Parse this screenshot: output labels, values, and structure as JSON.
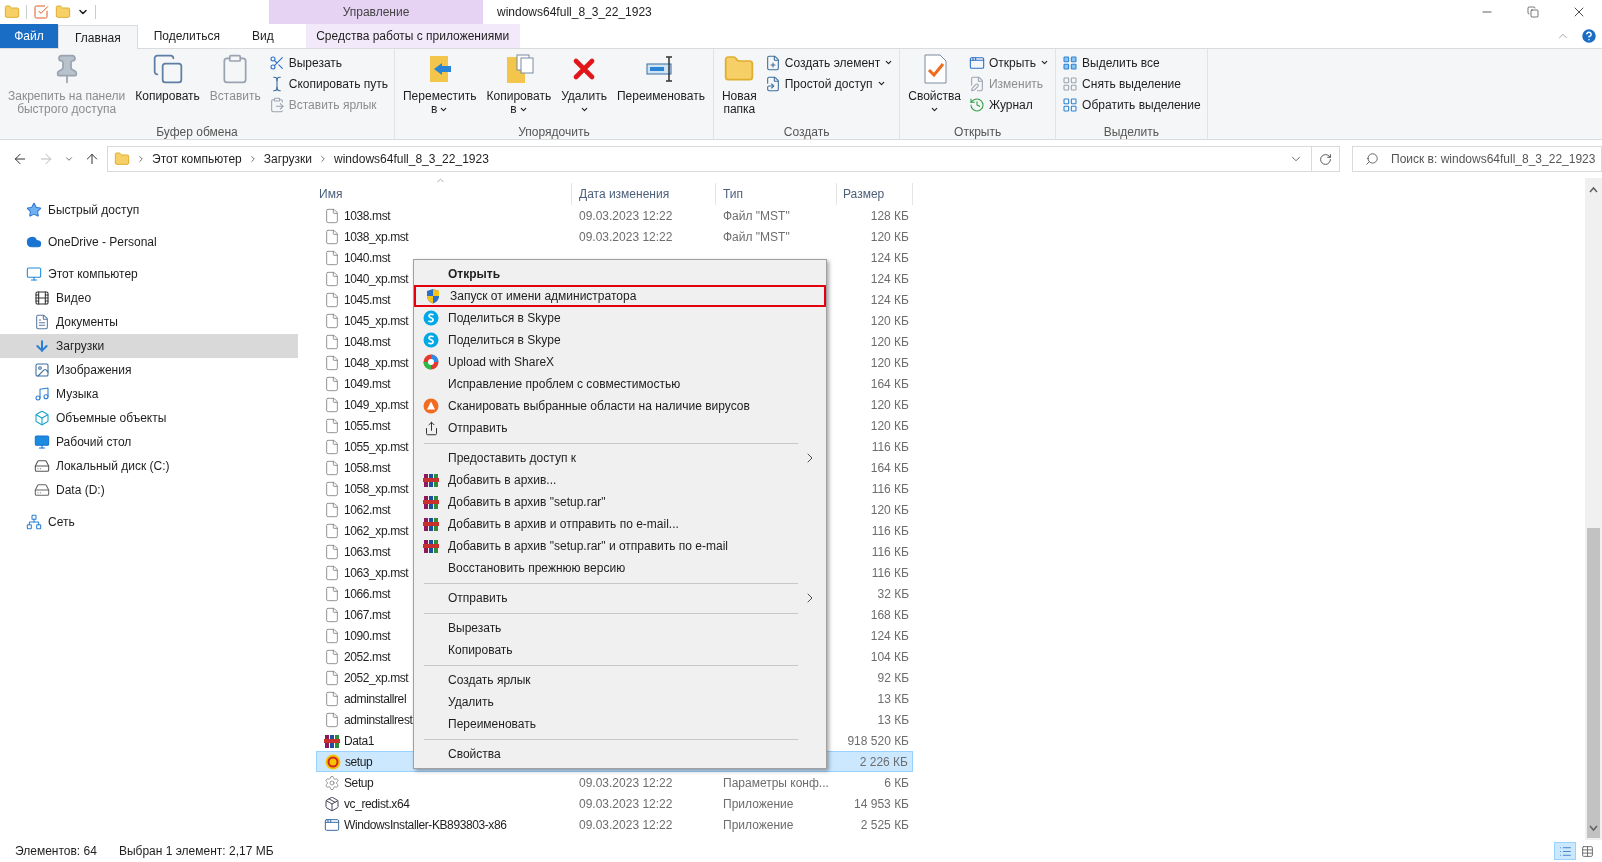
{
  "title_bar": {
    "contextual_header": "Управление",
    "title": "windows64full_8_3_22_1923"
  },
  "ribbon_tabs": [
    {
      "label": "Файл",
      "kind": "file",
      "selected": false
    },
    {
      "label": "Главная",
      "kind": "tab",
      "selected": true
    },
    {
      "label": "Поделиться",
      "kind": "tab",
      "selected": false
    },
    {
      "label": "Вид",
      "kind": "tab",
      "selected": false
    },
    {
      "label": "Средства работы с приложениями",
      "kind": "contextual",
      "selected": false
    }
  ],
  "ribbon_groups": [
    {
      "label": "Буфер обмена",
      "items": [
        {
          "kind": "pin",
          "lines": [
            "Закрепить на панели",
            "быстрого доступа"
          ],
          "disabled": true,
          "dropdown": false
        },
        {
          "kind": "copy",
          "lines": [
            "Копировать"
          ],
          "disabled": false,
          "dropdown": false
        },
        {
          "kind": "paste",
          "lines": [
            "Вставить"
          ],
          "disabled": true,
          "dropdown": false
        },
        {
          "stack": [
            {
              "kind": "cut",
              "label": "Вырезать",
              "disabled": false,
              "dropdown": false
            },
            {
              "kind": "copy-path",
              "label": "Скопировать путь",
              "disabled": false,
              "dropdown": false
            },
            {
              "kind": "paste-shortcut",
              "label": "Вставить ярлык",
              "disabled": true,
              "dropdown": false
            }
          ]
        }
      ]
    },
    {
      "label": "Упорядочить",
      "items": [
        {
          "kind": "move-to",
          "lines": [
            "Переместить",
            "в"
          ],
          "disabled": false,
          "dropdown": true
        },
        {
          "kind": "copy-to",
          "lines": [
            "Копировать",
            "в"
          ],
          "disabled": false,
          "dropdown": true
        },
        {
          "kind": "delete",
          "lines": [
            "Удалить"
          ],
          "disabled": false,
          "dropdown": true
        },
        {
          "kind": "rename",
          "lines": [
            "Переименовать"
          ],
          "disabled": false,
          "dropdown": false
        }
      ]
    },
    {
      "label": "Создать",
      "items": [
        {
          "kind": "new-folder",
          "lines": [
            "Новая",
            "папка"
          ],
          "disabled": false,
          "dropdown": false
        },
        {
          "stack": [
            {
              "kind": "new-item",
              "label": "Создать элемент",
              "disabled": false,
              "dropdown": true
            },
            {
              "kind": "easy-access",
              "label": "Простой доступ",
              "disabled": false,
              "dropdown": true
            }
          ]
        }
      ]
    },
    {
      "label": "Открыть",
      "items": [
        {
          "kind": "properties",
          "lines": [
            "Свойства"
          ],
          "disabled": false,
          "dropdown": true
        },
        {
          "stack": [
            {
              "kind": "open",
              "label": "Открыть",
              "disabled": false,
              "dropdown": true
            },
            {
              "kind": "edit",
              "label": "Изменить",
              "disabled": true,
              "dropdown": false
            },
            {
              "kind": "history",
              "label": "Журнал",
              "disabled": false,
              "dropdown": false
            }
          ]
        }
      ]
    },
    {
      "label": "Выделить",
      "items": [
        {
          "stack": [
            {
              "kind": "select-all",
              "label": "Выделить все",
              "disabled": false,
              "dropdown": false
            },
            {
              "kind": "select-none",
              "label": "Снять выделение",
              "disabled": false,
              "dropdown": false
            },
            {
              "kind": "invert",
              "label": "Обратить выделение",
              "disabled": false,
              "dropdown": false
            }
          ]
        }
      ]
    }
  ],
  "address_bar": {
    "path": [
      "Этот компьютер",
      "Загрузки",
      "windows64full_8_3_22_1923"
    ],
    "search_placeholder": "Поиск в: windows64full_8_3_22_1923"
  },
  "nav_pane": {
    "items": [
      {
        "label": "Быстрый доступ",
        "kind": "quick-access",
        "selected": false
      },
      {
        "label": "OneDrive - Personal",
        "kind": "cloud",
        "selected": false
      },
      {
        "label": "Этот компьютер",
        "kind": "computer",
        "selected": false,
        "children": [
          {
            "label": "Видео",
            "kind": "video",
            "selected": false
          },
          {
            "label": "Документы",
            "kind": "documents",
            "selected": false
          },
          {
            "label": "Загрузки",
            "kind": "downloads",
            "selected": true
          },
          {
            "label": "Изображения",
            "kind": "pictures",
            "selected": false
          },
          {
            "label": "Музыка",
            "kind": "music",
            "selected": false
          },
          {
            "label": "Объемные объекты",
            "kind": "objects",
            "selected": false
          },
          {
            "label": "Рабочий стол",
            "kind": "desktop",
            "selected": false
          },
          {
            "label": "Локальный диск (C:)",
            "kind": "system-drive",
            "selected": false
          },
          {
            "label": "Data (D:)",
            "kind": "drive",
            "selected": false
          }
        ]
      },
      {
        "label": "Сеть",
        "kind": "network",
        "selected": false
      }
    ]
  },
  "file_list": {
    "columns": [
      "Имя",
      "Дата изменения",
      "Тип",
      "Размер"
    ],
    "rows": [
      {
        "name": "1038.mst",
        "kind": "document",
        "date": "09.03.2023 12:22",
        "type": "Файл \"MST\"",
        "size": "128 КБ",
        "selected": false
      },
      {
        "name": "1038_xp.mst",
        "kind": "document",
        "date": "09.03.2023 12:22",
        "type": "Файл \"MST\"",
        "size": "120 КБ",
        "selected": false
      },
      {
        "name": "1040.mst",
        "kind": "document",
        "size": "124 КБ",
        "selected": false
      },
      {
        "name": "1040_xp.mst",
        "kind": "document",
        "size": "124 КБ",
        "selected": false
      },
      {
        "name": "1045.mst",
        "kind": "document",
        "size": "124 КБ",
        "selected": false
      },
      {
        "name": "1045_xp.mst",
        "kind": "document",
        "size": "120 КБ",
        "selected": false
      },
      {
        "name": "1048.mst",
        "kind": "document",
        "size": "120 КБ",
        "selected": false
      },
      {
        "name": "1048_xp.mst",
        "kind": "document",
        "size": "120 КБ",
        "selected": false
      },
      {
        "name": "1049.mst",
        "kind": "document",
        "size": "164 КБ",
        "selected": false
      },
      {
        "name": "1049_xp.mst",
        "kind": "document",
        "size": "120 КБ",
        "selected": false
      },
      {
        "name": "1055.mst",
        "kind": "document",
        "size": "120 КБ",
        "selected": false
      },
      {
        "name": "1055_xp.mst",
        "kind": "document",
        "size": "116 КБ",
        "selected": false
      },
      {
        "name": "1058.mst",
        "kind": "document",
        "size": "164 КБ",
        "selected": false
      },
      {
        "name": "1058_xp.mst",
        "kind": "document",
        "size": "116 КБ",
        "selected": false
      },
      {
        "name": "1062.mst",
        "kind": "document",
        "size": "120 КБ",
        "selected": false
      },
      {
        "name": "1062_xp.mst",
        "kind": "document",
        "size": "116 КБ",
        "selected": false
      },
      {
        "name": "1063.mst",
        "kind": "document",
        "size": "116 КБ",
        "selected": false
      },
      {
        "name": "1063_xp.mst",
        "kind": "document",
        "size": "116 КБ",
        "selected": false
      },
      {
        "name": "1066.mst",
        "kind": "document",
        "size": "32 КБ",
        "selected": false
      },
      {
        "name": "1067.mst",
        "kind": "document",
        "size": "168 КБ",
        "selected": false
      },
      {
        "name": "1090.mst",
        "kind": "document",
        "size": "124 КБ",
        "selected": false
      },
      {
        "name": "2052.mst",
        "kind": "document",
        "size": "104 КБ",
        "selected": false
      },
      {
        "name": "2052_xp.mst",
        "kind": "document",
        "size": "92 КБ",
        "selected": false
      },
      {
        "name": "adminstallrel",
        "kind": "document",
        "size": "13 КБ",
        "selected": false
      },
      {
        "name": "adminstallrest",
        "kind": "document",
        "size": "13 КБ",
        "selected": false
      },
      {
        "name": "Data1",
        "kind": "archive",
        "size": "918 520 КБ",
        "selected": false
      },
      {
        "name": "setup",
        "kind": "app",
        "size": "2 226 КБ",
        "selected": true
      },
      {
        "name": "Setup",
        "kind": "config",
        "date": "09.03.2023 12:22",
        "type": "Параметры конф...",
        "size": "6 КБ",
        "selected": false
      },
      {
        "name": "vc_redist.x64",
        "kind": "installer",
        "date": "09.03.2023 12:22",
        "type": "Приложение",
        "size": "14 953 КБ",
        "selected": false
      },
      {
        "name": "WindowsInstaller-KB893803-x86",
        "kind": "window-app",
        "date": "09.03.2023 12:22",
        "type": "Приложение",
        "size": "2 525 КБ",
        "selected": false
      }
    ]
  },
  "context_menu": {
    "items": [
      {
        "kind": "plain",
        "label": "Открыть",
        "default": true,
        "highlighted": false
      },
      {
        "kind": "shield",
        "label": "Запуск от имени администратора",
        "default": false,
        "highlighted": true
      },
      {
        "kind": "skype",
        "label": "Поделиться в Skype",
        "default": false,
        "highlighted": false
      },
      {
        "kind": "skype",
        "label": "Поделиться в Skype",
        "default": false,
        "highlighted": false
      },
      {
        "kind": "sharex",
        "label": "Upload with ShareX",
        "default": false,
        "highlighted": false
      },
      {
        "kind": "plain",
        "label": "Исправление проблем с совместимостью",
        "default": false,
        "highlighted": false
      },
      {
        "kind": "antivirus",
        "label": "Сканировать выбранные области на наличие вирусов",
        "default": false,
        "highlighted": false
      },
      {
        "kind": "send",
        "label": "Отправить",
        "default": false,
        "highlighted": false
      },
      {
        "kind": "separator"
      },
      {
        "kind": "submenu",
        "label": "Предоставить доступ к",
        "default": false,
        "highlighted": false
      },
      {
        "kind": "archive",
        "label": "Добавить в архив...",
        "default": false,
        "highlighted": false
      },
      {
        "kind": "archive",
        "label": "Добавить в архив \"setup.rar\"",
        "default": false,
        "highlighted": false
      },
      {
        "kind": "archive",
        "label": "Добавить в архив и отправить по e-mail...",
        "default": false,
        "highlighted": false
      },
      {
        "kind": "archive",
        "label": "Добавить в архив \"setup.rar\" и отправить по e-mail",
        "default": false,
        "highlighted": false
      },
      {
        "kind": "plain",
        "label": "Восстановить прежнюю версию",
        "default": false,
        "highlighted": false
      },
      {
        "kind": "separator"
      },
      {
        "kind": "submenu",
        "label": "Отправить",
        "default": false,
        "highlighted": false
      },
      {
        "kind": "separator"
      },
      {
        "kind": "plain",
        "label": "Вырезать",
        "default": false,
        "highlighted": false
      },
      {
        "kind": "plain",
        "label": "Копировать",
        "default": false,
        "highlighted": false
      },
      {
        "kind": "separator"
      },
      {
        "kind": "plain",
        "label": "Создать ярлык",
        "default": false,
        "highlighted": false
      },
      {
        "kind": "plain",
        "label": "Удалить",
        "default": false,
        "highlighted": false
      },
      {
        "kind": "plain",
        "label": "Переименовать",
        "default": false,
        "highlighted": false
      },
      {
        "kind": "separator"
      },
      {
        "kind": "plain",
        "label": "Свойства",
        "default": false,
        "highlighted": false
      }
    ]
  },
  "status_bar": {
    "item_count": "Элементов: 64",
    "selection": "Выбран 1 элемент: 2,17 МБ"
  }
}
